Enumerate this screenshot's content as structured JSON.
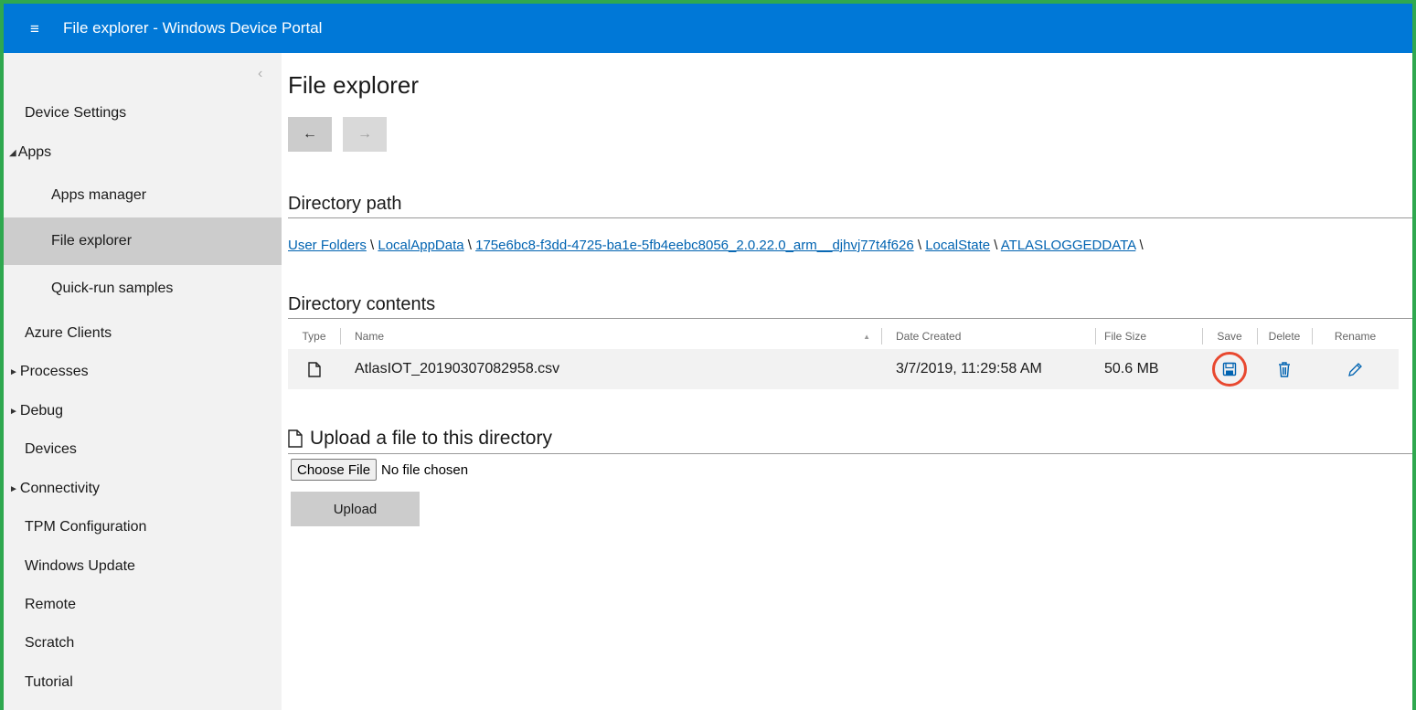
{
  "window": {
    "title": "File explorer - Windows Device Portal"
  },
  "sidebar": {
    "items": [
      {
        "label": "Device Settings"
      },
      {
        "label": "Apps",
        "expanded": true
      },
      {
        "label": "Apps manager"
      },
      {
        "label": "File explorer",
        "selected": true
      },
      {
        "label": "Quick-run samples"
      },
      {
        "label": "Azure Clients"
      },
      {
        "label": "Processes",
        "expanded": false
      },
      {
        "label": "Debug",
        "expanded": false
      },
      {
        "label": "Devices"
      },
      {
        "label": "Connectivity",
        "expanded": false
      },
      {
        "label": "TPM Configuration"
      },
      {
        "label": "Windows Update"
      },
      {
        "label": "Remote"
      },
      {
        "label": "Scratch"
      },
      {
        "label": "Tutorial"
      }
    ]
  },
  "main": {
    "title": "File explorer",
    "directory_path": {
      "heading": "Directory path",
      "segments": [
        "User Folders",
        "LocalAppData",
        "175e6bc8-f3dd-4725-ba1e-5fb4eebc8056_2.0.22.0_arm__djhvj77t4f626",
        "LocalState",
        "ATLASLOGGEDDATA"
      ]
    },
    "directory_contents": {
      "heading": "Directory contents",
      "columns": [
        "Type",
        "Name",
        "Date Created",
        "File Size",
        "Save",
        "Delete",
        "Rename"
      ],
      "rows": [
        {
          "name": "AtlasIOT_20190307082958.csv",
          "date_created": "3/7/2019, 11:29:58 AM",
          "file_size": "50.6 MB"
        }
      ]
    },
    "upload": {
      "heading": "Upload a file to this directory",
      "choose_label": "Choose File",
      "no_file": "No file chosen",
      "upload_label": "Upload"
    }
  },
  "colors": {
    "titlebar": "#0078d7",
    "link": "#0063b1",
    "highlight_ring": "#e8482f",
    "border": "#2fa84f"
  },
  "icons": {
    "menu": "hamburger-icon",
    "back": "arrow-left-icon",
    "forward": "arrow-right-icon",
    "file": "file-icon",
    "save": "floppy-disk-icon",
    "delete": "trash-icon",
    "rename": "pencil-icon"
  }
}
